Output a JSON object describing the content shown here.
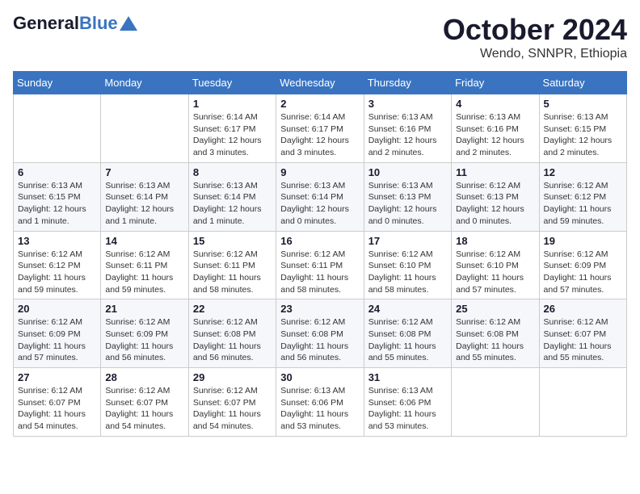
{
  "header": {
    "logo_general": "General",
    "logo_blue": "Blue",
    "month_title": "October 2024",
    "location": "Wendo, SNNPR, Ethiopia"
  },
  "days_of_week": [
    "Sunday",
    "Monday",
    "Tuesday",
    "Wednesday",
    "Thursday",
    "Friday",
    "Saturday"
  ],
  "weeks": [
    [
      {
        "day": "",
        "info": ""
      },
      {
        "day": "",
        "info": ""
      },
      {
        "day": "1",
        "info": "Sunrise: 6:14 AM\nSunset: 6:17 PM\nDaylight: 12 hours and 3 minutes."
      },
      {
        "day": "2",
        "info": "Sunrise: 6:14 AM\nSunset: 6:17 PM\nDaylight: 12 hours and 3 minutes."
      },
      {
        "day": "3",
        "info": "Sunrise: 6:13 AM\nSunset: 6:16 PM\nDaylight: 12 hours and 2 minutes."
      },
      {
        "day": "4",
        "info": "Sunrise: 6:13 AM\nSunset: 6:16 PM\nDaylight: 12 hours and 2 minutes."
      },
      {
        "day": "5",
        "info": "Sunrise: 6:13 AM\nSunset: 6:15 PM\nDaylight: 12 hours and 2 minutes."
      }
    ],
    [
      {
        "day": "6",
        "info": "Sunrise: 6:13 AM\nSunset: 6:15 PM\nDaylight: 12 hours and 1 minute."
      },
      {
        "day": "7",
        "info": "Sunrise: 6:13 AM\nSunset: 6:14 PM\nDaylight: 12 hours and 1 minute."
      },
      {
        "day": "8",
        "info": "Sunrise: 6:13 AM\nSunset: 6:14 PM\nDaylight: 12 hours and 1 minute."
      },
      {
        "day": "9",
        "info": "Sunrise: 6:13 AM\nSunset: 6:14 PM\nDaylight: 12 hours and 0 minutes."
      },
      {
        "day": "10",
        "info": "Sunrise: 6:13 AM\nSunset: 6:13 PM\nDaylight: 12 hours and 0 minutes."
      },
      {
        "day": "11",
        "info": "Sunrise: 6:12 AM\nSunset: 6:13 PM\nDaylight: 12 hours and 0 minutes."
      },
      {
        "day": "12",
        "info": "Sunrise: 6:12 AM\nSunset: 6:12 PM\nDaylight: 11 hours and 59 minutes."
      }
    ],
    [
      {
        "day": "13",
        "info": "Sunrise: 6:12 AM\nSunset: 6:12 PM\nDaylight: 11 hours and 59 minutes."
      },
      {
        "day": "14",
        "info": "Sunrise: 6:12 AM\nSunset: 6:11 PM\nDaylight: 11 hours and 59 minutes."
      },
      {
        "day": "15",
        "info": "Sunrise: 6:12 AM\nSunset: 6:11 PM\nDaylight: 11 hours and 58 minutes."
      },
      {
        "day": "16",
        "info": "Sunrise: 6:12 AM\nSunset: 6:11 PM\nDaylight: 11 hours and 58 minutes."
      },
      {
        "day": "17",
        "info": "Sunrise: 6:12 AM\nSunset: 6:10 PM\nDaylight: 11 hours and 58 minutes."
      },
      {
        "day": "18",
        "info": "Sunrise: 6:12 AM\nSunset: 6:10 PM\nDaylight: 11 hours and 57 minutes."
      },
      {
        "day": "19",
        "info": "Sunrise: 6:12 AM\nSunset: 6:09 PM\nDaylight: 11 hours and 57 minutes."
      }
    ],
    [
      {
        "day": "20",
        "info": "Sunrise: 6:12 AM\nSunset: 6:09 PM\nDaylight: 11 hours and 57 minutes."
      },
      {
        "day": "21",
        "info": "Sunrise: 6:12 AM\nSunset: 6:09 PM\nDaylight: 11 hours and 56 minutes."
      },
      {
        "day": "22",
        "info": "Sunrise: 6:12 AM\nSunset: 6:08 PM\nDaylight: 11 hours and 56 minutes."
      },
      {
        "day": "23",
        "info": "Sunrise: 6:12 AM\nSunset: 6:08 PM\nDaylight: 11 hours and 56 minutes."
      },
      {
        "day": "24",
        "info": "Sunrise: 6:12 AM\nSunset: 6:08 PM\nDaylight: 11 hours and 55 minutes."
      },
      {
        "day": "25",
        "info": "Sunrise: 6:12 AM\nSunset: 6:08 PM\nDaylight: 11 hours and 55 minutes."
      },
      {
        "day": "26",
        "info": "Sunrise: 6:12 AM\nSunset: 6:07 PM\nDaylight: 11 hours and 55 minutes."
      }
    ],
    [
      {
        "day": "27",
        "info": "Sunrise: 6:12 AM\nSunset: 6:07 PM\nDaylight: 11 hours and 54 minutes."
      },
      {
        "day": "28",
        "info": "Sunrise: 6:12 AM\nSunset: 6:07 PM\nDaylight: 11 hours and 54 minutes."
      },
      {
        "day": "29",
        "info": "Sunrise: 6:12 AM\nSunset: 6:07 PM\nDaylight: 11 hours and 54 minutes."
      },
      {
        "day": "30",
        "info": "Sunrise: 6:13 AM\nSunset: 6:06 PM\nDaylight: 11 hours and 53 minutes."
      },
      {
        "day": "31",
        "info": "Sunrise: 6:13 AM\nSunset: 6:06 PM\nDaylight: 11 hours and 53 minutes."
      },
      {
        "day": "",
        "info": ""
      },
      {
        "day": "",
        "info": ""
      }
    ]
  ]
}
